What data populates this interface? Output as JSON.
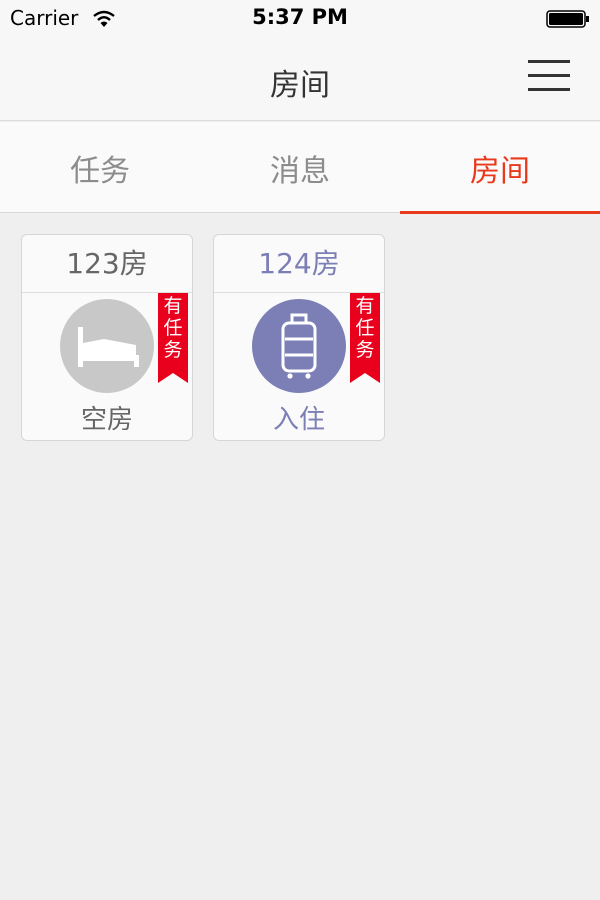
{
  "status_bar": {
    "carrier": "Carrier",
    "time": "5:37 PM"
  },
  "nav": {
    "title": "房间"
  },
  "tabs": [
    {
      "label": "任务",
      "active": false
    },
    {
      "label": "消息",
      "active": false
    },
    {
      "label": "房间",
      "active": true
    }
  ],
  "rooms": [
    {
      "name": "123房",
      "status": "空房",
      "badge": "有任务",
      "icon": "bed-icon",
      "color": "#666666",
      "circle_color": "#c8c8c8"
    },
    {
      "name": "124房",
      "status": "入住",
      "badge": "有任务",
      "icon": "luggage-icon",
      "color": "#7b7fb5",
      "circle_color": "#7b7fb5"
    }
  ],
  "colors": {
    "accent": "#e8391c",
    "badge": "#e8001c",
    "checked_in": "#7b7fb5",
    "vacant": "#c8c8c8"
  }
}
